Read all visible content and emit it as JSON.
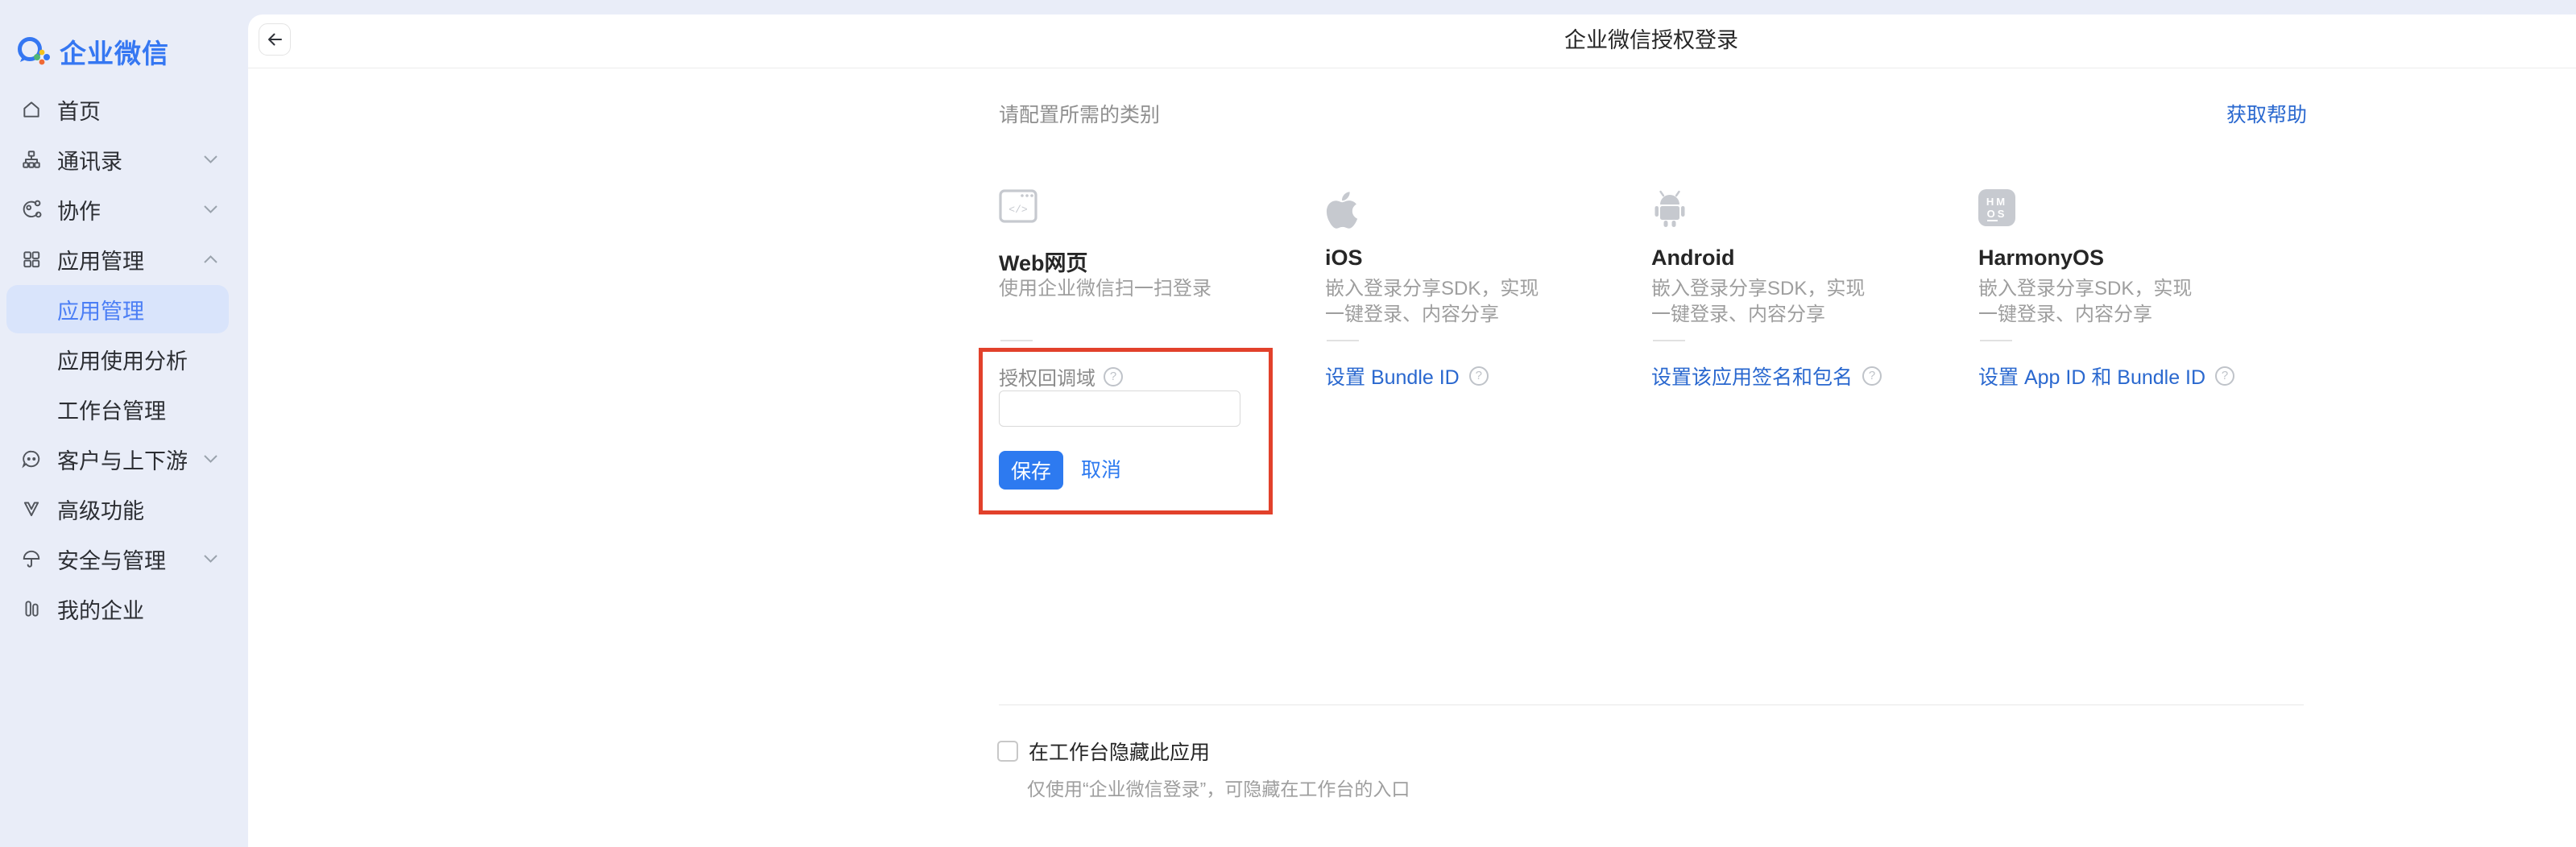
{
  "brand": {
    "name": "企业微信"
  },
  "sidebar": {
    "items_top": [
      {
        "label": "首页"
      },
      {
        "label": "通讯录"
      },
      {
        "label": "协作"
      },
      {
        "label": "应用管理"
      }
    ],
    "items_sub": [
      {
        "label": "应用管理"
      },
      {
        "label": "应用使用分析"
      },
      {
        "label": "工作台管理"
      }
    ],
    "items_bottom": [
      {
        "label": "客户与上下游"
      },
      {
        "label": "高级功能"
      },
      {
        "label": "安全与管理"
      },
      {
        "label": "我的企业"
      }
    ]
  },
  "header": {
    "title": "企业微信授权登录"
  },
  "main": {
    "config_hint": "请配置所需的类别",
    "help_link": "获取帮助",
    "cards": {
      "web": {
        "title": "Web网页",
        "desc": "使用企业微信扫一扫登录",
        "form": {
          "label": "授权回调域",
          "input_value": "",
          "save": "保存",
          "cancel": "取消"
        }
      },
      "ios": {
        "title": "iOS",
        "desc_line1": "嵌入登录分享SDK，实现",
        "desc_line2": "一键登录、内容分享",
        "link": "设置 Bundle ID"
      },
      "android": {
        "title": "Android",
        "desc_line1": "嵌入登录分享SDK，实现",
        "desc_line2": "一键登录、内容分享",
        "link": "设置该应用签名和包名"
      },
      "harmonyos": {
        "title": "HarmonyOS",
        "desc_line1": "嵌入登录分享SDK，实现",
        "desc_line2": "一键登录、内容分享",
        "link": "设置 App ID 和 Bundle ID",
        "icon_text_top": "HM",
        "icon_o": "O",
        "icon_s": "S"
      }
    },
    "hide_section": {
      "label": "在工作台隐藏此应用",
      "desc": "仅使用“企业微信登录”，可隐藏在工作台的入口"
    }
  },
  "colors": {
    "accent_blue": "#2d7af0",
    "link_blue": "#2a68cf",
    "sidebar_active_blue": "#4b7ef5",
    "highlight_red": "#e2412b",
    "sidebar_bg": "#e9edf8"
  }
}
